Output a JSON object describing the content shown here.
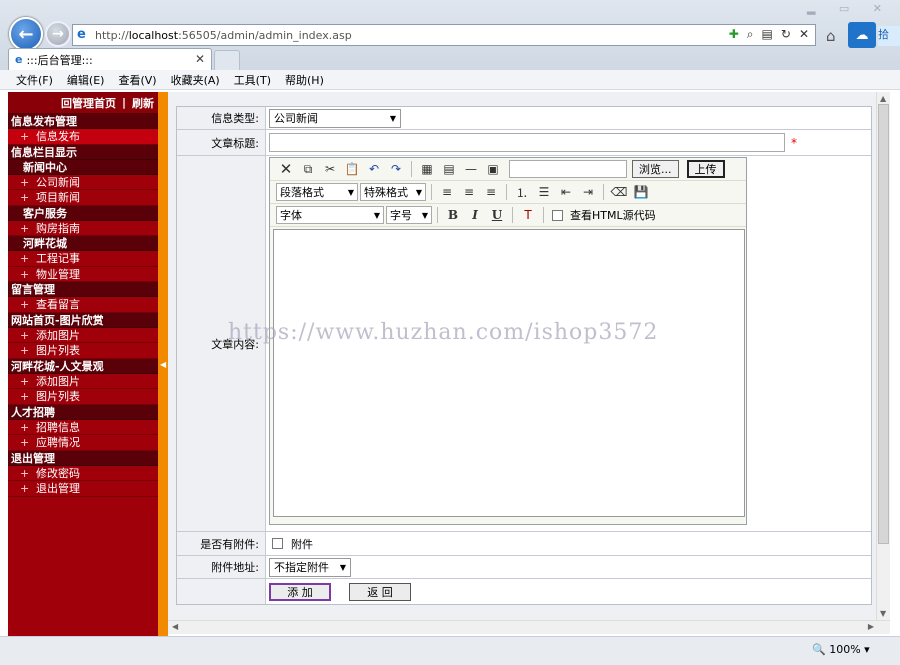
{
  "browser": {
    "url_prefix": "http://",
    "url_host": "localhost",
    "url_rest": ":56505/admin/admin_index.asp",
    "tab_title": ":::后台管理:::",
    "top_right_text": "拾",
    "menu": [
      "文件(F)",
      "编辑(E)",
      "查看(V)",
      "收藏夹(A)",
      "工具(T)",
      "帮助(H)"
    ],
    "zoom": "100%"
  },
  "sidebar": {
    "home_link": "回管理首页",
    "refresh_link": "刷新",
    "separator": "|",
    "groups": [
      {
        "type": "section",
        "label": "信息发布管理"
      },
      {
        "type": "item",
        "label": "信息发布",
        "active": true
      },
      {
        "type": "section",
        "label": "信息栏目显示"
      },
      {
        "type": "sub",
        "label": "新闻中心"
      },
      {
        "type": "item",
        "label": "公司新闻"
      },
      {
        "type": "item",
        "label": "项目新闻"
      },
      {
        "type": "sub",
        "label": "客户服务"
      },
      {
        "type": "item",
        "label": "购房指南"
      },
      {
        "type": "sub",
        "label": "河畔花城"
      },
      {
        "type": "item",
        "label": "工程记事"
      },
      {
        "type": "item",
        "label": "物业管理"
      },
      {
        "type": "section",
        "label": "留言管理"
      },
      {
        "type": "item",
        "label": "查看留言"
      },
      {
        "type": "section",
        "label": "网站首页-图片欣赏"
      },
      {
        "type": "item",
        "label": "添加图片"
      },
      {
        "type": "item",
        "label": "图片列表"
      },
      {
        "type": "section",
        "label": "河畔花城-人文景观"
      },
      {
        "type": "item",
        "label": "添加图片"
      },
      {
        "type": "item",
        "label": "图片列表"
      },
      {
        "type": "section",
        "label": "人才招聘"
      },
      {
        "type": "item",
        "label": "招聘信息"
      },
      {
        "type": "item",
        "label": "应聘情况"
      },
      {
        "type": "section",
        "label": "退出管理"
      },
      {
        "type": "item",
        "label": "修改密码"
      },
      {
        "type": "item",
        "label": "退出管理"
      }
    ]
  },
  "form": {
    "info_type_label": "信息类型:",
    "info_type_value": "公司新闻",
    "title_label": "文章标题:",
    "title_required": "*",
    "content_label": "文章内容:",
    "attachment_label": "是否有附件:",
    "attachment_checkbox": "附件",
    "attachment_addr_label": "附件地址:",
    "attachment_addr_value": "不指定附件",
    "add_button": "添 加",
    "back_button": "返 回"
  },
  "editor": {
    "browse_button": "浏览...",
    "upload_button": "上传",
    "para_format": "段落格式",
    "special_format": "特殊格式",
    "font": "字体",
    "font_size": "字号",
    "bold": "B",
    "italic": "I",
    "underline": "U",
    "view_source": "查看HTML源代码"
  },
  "watermark": "https://www.huzhan.com/ishop3572"
}
